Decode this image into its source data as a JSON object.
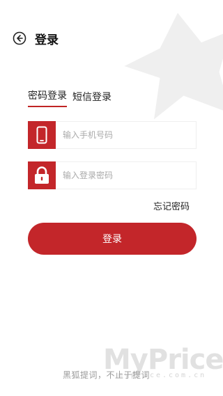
{
  "header": {
    "back_icon": "circle-arrow-left-icon",
    "title": "登录"
  },
  "tabs": [
    {
      "label": "密码登录",
      "active": true
    },
    {
      "label": "短信登录",
      "active": false
    }
  ],
  "phone_field": {
    "icon": "mobile-phone-icon",
    "value": "",
    "placeholder": "输入手机号码"
  },
  "password_field": {
    "icon": "lock-icon",
    "value": "",
    "placeholder": "输入登录密码"
  },
  "forgot_label": "忘记密码",
  "login_label": "登录",
  "slogan": "黑狐提词，不止于提词",
  "watermark": {
    "main": "MyPrice",
    "sub": "myprice.com.cn"
  },
  "colors": {
    "accent": "#c3262a",
    "background": "#ffffff",
    "placeholder": "#aaaaaa"
  }
}
